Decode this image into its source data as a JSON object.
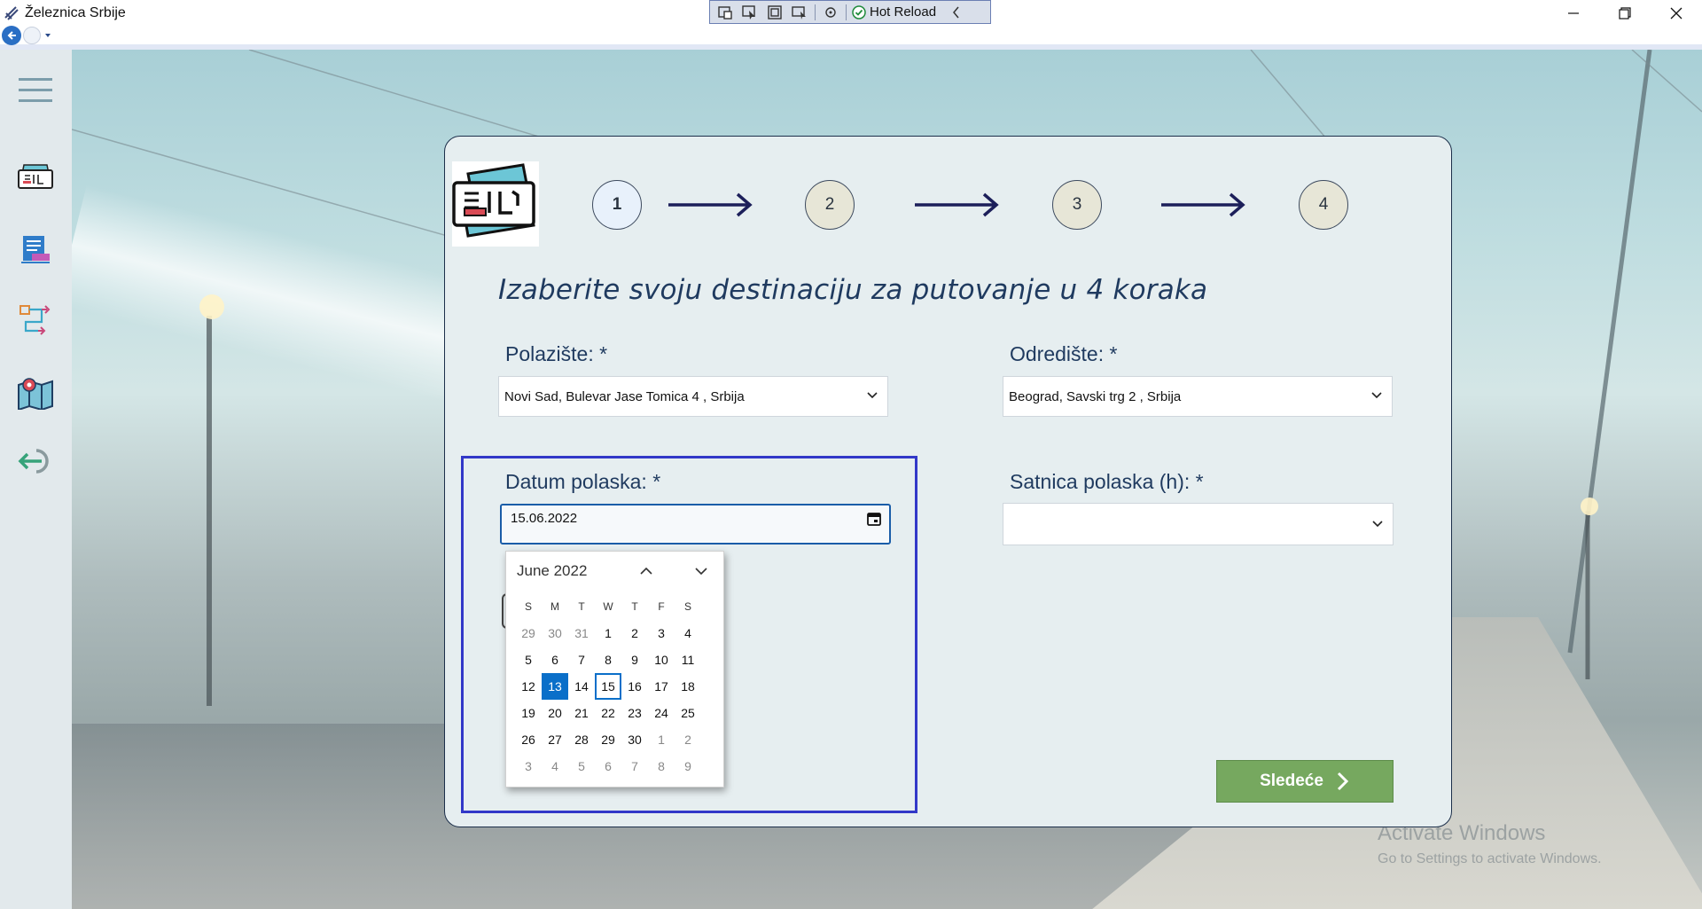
{
  "window": {
    "title": "Železnica Srbije",
    "devtools": {
      "hot_reload_label": "Hot Reload"
    }
  },
  "watermark": {
    "line1": "Activate Windows",
    "line2": "Go to Settings to activate Windows."
  },
  "sidebar": {
    "items": [
      {
        "name": "menu-icon"
      },
      {
        "name": "ticket-icon"
      },
      {
        "name": "timetable-icon"
      },
      {
        "name": "route-icon"
      },
      {
        "name": "map-icon"
      },
      {
        "name": "logout-icon"
      }
    ]
  },
  "wizard": {
    "steps": [
      "1",
      "2",
      "3",
      "4"
    ],
    "active_step": 1,
    "heading": "Izaberite svoju destinaciju za putovanje u 4 koraka"
  },
  "form": {
    "origin_label": "Polazište: *",
    "origin_value": "Novi Sad, Bulevar Jase Tomica 4 , Srbija",
    "destination_label": "Odredište: *",
    "destination_value": "Beograd, Savski trg 2 , Srbija",
    "date_label": "Datum polaska: *",
    "date_value": "15.06.2022",
    "time_label": "Satnica polaska (h): *",
    "time_value": ""
  },
  "calendar": {
    "month_label": "June 2022",
    "weekdays": [
      "S",
      "M",
      "T",
      "W",
      "T",
      "F",
      "S"
    ],
    "weeks": [
      [
        "29",
        "30",
        "31",
        "1",
        "2",
        "3",
        "4"
      ],
      [
        "5",
        "6",
        "7",
        "8",
        "9",
        "10",
        "11"
      ],
      [
        "12",
        "13",
        "14",
        "15",
        "16",
        "17",
        "18"
      ],
      [
        "19",
        "20",
        "21",
        "22",
        "23",
        "24",
        "25"
      ],
      [
        "26",
        "27",
        "28",
        "29",
        "30",
        "1",
        "2"
      ],
      [
        "3",
        "4",
        "5",
        "6",
        "7",
        "8",
        "9"
      ]
    ],
    "selected_day": "13",
    "today_day": "15"
  },
  "next_button": {
    "label": "Sledeće"
  },
  "colors": {
    "accent": "#1f3a5f",
    "selected": "#0a6fc9",
    "next_button": "#76a85f",
    "focus_box": "#3238c8"
  }
}
